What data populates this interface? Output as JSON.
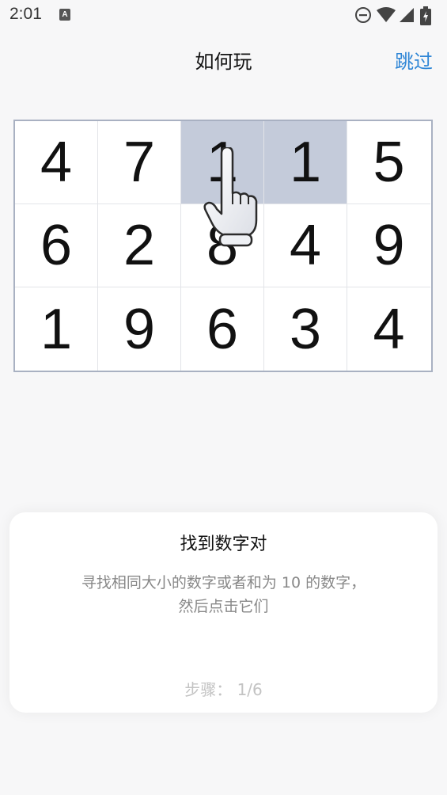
{
  "status_bar": {
    "time": "2:01",
    "notification_icon": "a-letter-icon",
    "icons": [
      "do-not-disturb-icon",
      "wifi-icon",
      "cell-signal-icon",
      "battery-charging-icon"
    ]
  },
  "header": {
    "title": "如何玩",
    "skip_label": "跳过",
    "skip_color": "#2f86d6"
  },
  "board": {
    "rows": [
      [
        "4",
        "7",
        "1",
        "1",
        "5"
      ],
      [
        "6",
        "2",
        "8",
        "4",
        "9"
      ],
      [
        "1",
        "9",
        "6",
        "3",
        "4"
      ]
    ],
    "highlight_color": "#c4cbda",
    "pointer_icon": "pointing-hand-icon"
  },
  "tutorial": {
    "title": "找到数字对",
    "description_line1": "寻找相同大小的数字或者和为 10 的数字，",
    "description_line2": "然后点击它们",
    "step": "步骤： 1/6"
  }
}
